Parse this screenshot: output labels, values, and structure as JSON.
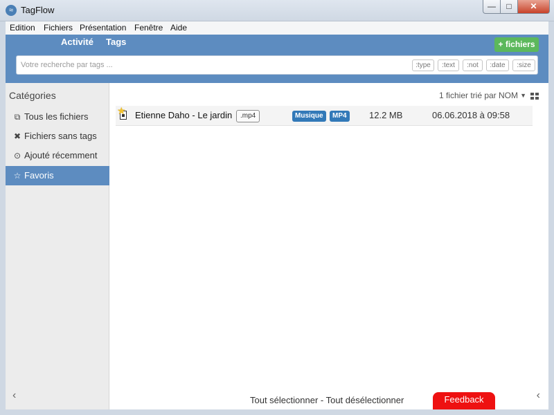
{
  "window": {
    "title": "TagFlow",
    "controls": {
      "minimize": "—",
      "maximize": "□",
      "close": "✕"
    }
  },
  "menu": [
    "Edition",
    "Fichiers",
    "Présentation",
    "Fenêtre",
    "Aide"
  ],
  "header": {
    "nav": [
      "Activité",
      "Tags"
    ],
    "add_files_label": "+ fichiers",
    "search_placeholder": "Votre recherche par tags ...",
    "filters": [
      ":type",
      ":text",
      ":not",
      ":date",
      ":size"
    ]
  },
  "sidebar": {
    "title": "Catégories",
    "items": [
      {
        "label": "Tous les fichiers",
        "icon": "copy-icon",
        "glyph": "⧉"
      },
      {
        "label": "Fichiers sans tags",
        "icon": "x-icon",
        "glyph": "✖"
      },
      {
        "label": "Ajouté récemment",
        "icon": "clock-icon",
        "glyph": "⊙"
      },
      {
        "label": "Favoris",
        "icon": "star-outline-icon",
        "glyph": "☆",
        "active": true
      }
    ],
    "back_glyph": "‹"
  },
  "main": {
    "sort_info": "1 fichier trié par NOM",
    "sort_caret": "▼",
    "files": [
      {
        "name": "Etienne Daho - Le jardin",
        "extension": ".mp4",
        "tags": [
          "Musique",
          "MP4"
        ],
        "size": "12.2 MB",
        "date": "06.06.2018 à 09:58",
        "favorite": true
      }
    ],
    "select_links": "Tout sélectionner - Tout désélectionner",
    "feedback_label": "Feedback",
    "forward_glyph": "‹"
  },
  "colors": {
    "header_blue": "#5d8cc0",
    "tag_blue": "#3279b8",
    "add_green": "#5cb85c",
    "feedback_red": "#ee1111"
  }
}
